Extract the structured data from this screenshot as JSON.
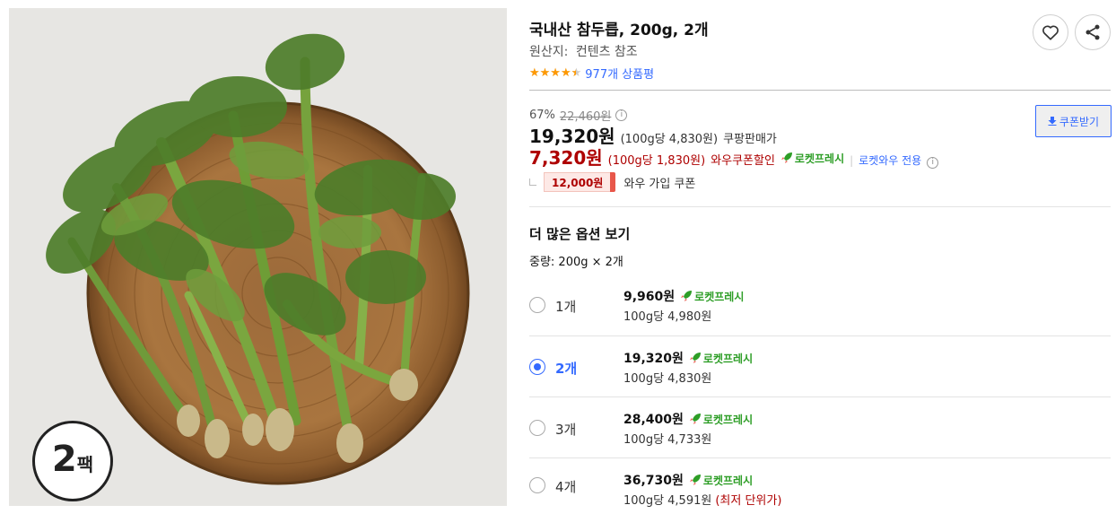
{
  "product": {
    "title": "국내산 참두릅, 200g, 2개",
    "origin_label": "원산지:",
    "origin_value": "컨텐츠 참조",
    "rating": 4.5,
    "rating_max": 5,
    "review_count_text": "977개 상품평",
    "badge": {
      "number": "2",
      "unit": "팩"
    }
  },
  "actions": {
    "wishlist_icon": "heart-icon",
    "share_icon": "share-icon",
    "coupon_button": "쿠폰받기"
  },
  "pricing": {
    "discount_rate": "67%",
    "original_price": "22,460원",
    "sale_price": "19,320원",
    "sale_unit_note": "(100g당 4,830원)",
    "sale_label": "쿠팡판매가",
    "wow_price": "7,320원",
    "wow_unit_note": "(100g당 1,830원)",
    "wow_label": "와우쿠폰할인",
    "rocket_label": "로켓프레시",
    "separator": "|",
    "wow_only_label": "로켓와우 전용",
    "coupon_amount": "12,000원",
    "coupon_text": "와우 가입 쿠폰"
  },
  "options": {
    "title": "더 많은 옵션 보기",
    "weight_line": "중량: 200g × 2개",
    "items": [
      {
        "qty": "1개",
        "price": "9,960원",
        "rocket": "로켓프레시",
        "per_unit": "100g당 4,980원",
        "note": "",
        "selected": false
      },
      {
        "qty": "2개",
        "price": "19,320원",
        "rocket": "로켓프레시",
        "per_unit": "100g당 4,830원",
        "note": "",
        "selected": true
      },
      {
        "qty": "3개",
        "price": "28,400원",
        "rocket": "로켓프레시",
        "per_unit": "100g당 4,733원",
        "note": "",
        "selected": false
      },
      {
        "qty": "4개",
        "price": "36,730원",
        "rocket": "로켓프레시",
        "per_unit": "100g당 4,591원",
        "note": "(최저 단위가)",
        "selected": false
      }
    ]
  },
  "colors": {
    "accent_blue": "#346aff",
    "wow_red": "#ae0000",
    "rocket_green": "#2e9e27",
    "star_orange": "#ff9900"
  }
}
